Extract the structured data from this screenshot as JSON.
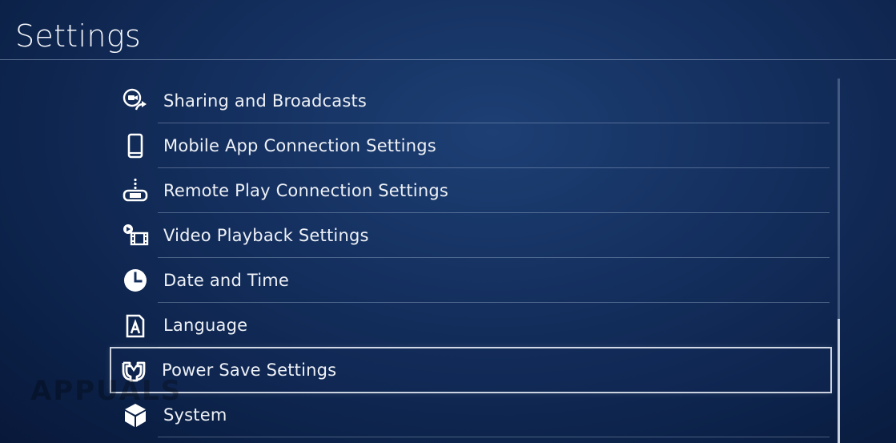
{
  "header": {
    "title": "Settings"
  },
  "menu": {
    "items": [
      {
        "label": "Sharing and Broadcasts",
        "icon": "share-broadcast-icon"
      },
      {
        "label": "Mobile App Connection Settings",
        "icon": "mobile-phone-icon"
      },
      {
        "label": "Remote Play Connection Settings",
        "icon": "remote-play-icon"
      },
      {
        "label": "Video Playback Settings",
        "icon": "video-playback-icon"
      },
      {
        "label": "Date and Time",
        "icon": "clock-icon"
      },
      {
        "label": "Language",
        "icon": "language-icon"
      },
      {
        "label": "Power Save Settings",
        "icon": "power-save-icon",
        "selected": true
      },
      {
        "label": "System",
        "icon": "system-cube-icon"
      }
    ]
  },
  "watermark": {
    "text": "APPUALS"
  },
  "colors": {
    "background": "#142f5e",
    "text": "#eef1f6",
    "divider": "#bdcde6",
    "selection_outline": "#ebf0f8"
  }
}
